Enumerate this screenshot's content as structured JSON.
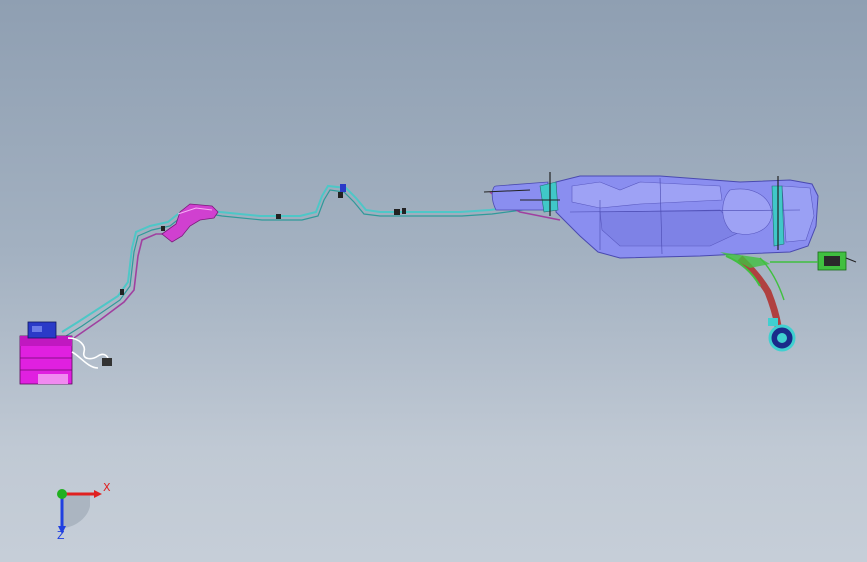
{
  "viewport": {
    "background_top": "#8f9fb2",
    "background_bottom": "#c6ced8"
  },
  "model": {
    "colors": {
      "pump_module": "#e020e0",
      "pump_cap": "#2a3ac8",
      "fuel_line": "#50c8c8",
      "vapor_line": "#a040a0",
      "tank_body": "#8a8ef0",
      "tank_edge": "#4a4ab0",
      "mount_bracket": "#d040d0",
      "filler_pipe": "#b04040",
      "filler_ring": "#40d0d0",
      "connector": "#40c040"
    }
  },
  "triad": {
    "x_label": "X",
    "z_label": "Z",
    "x_color": "#e02020",
    "y_color": "#20b020",
    "z_color": "#2040e0"
  }
}
